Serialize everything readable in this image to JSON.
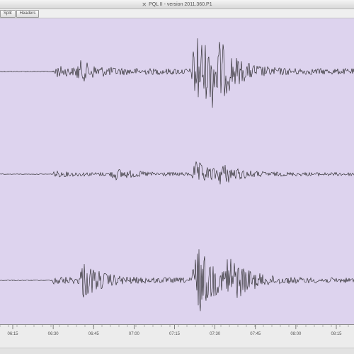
{
  "window": {
    "title": "PQL II - version 2011.360.P1",
    "title_icon": "x-window-icon"
  },
  "toolbar": {
    "buttons": [
      "Split",
      "Headers"
    ]
  },
  "plot": {
    "background": "#ddd3ee",
    "trace_color": "#1a1a1a",
    "traces": [
      {
        "id": "trace-1",
        "events": [
          {
            "t": 0.15,
            "amp": 0.08
          },
          {
            "t": 0.22,
            "amp": 0.18
          },
          {
            "t": 0.55,
            "amp": 0.95
          },
          {
            "t": 0.6,
            "amp": 0.55
          }
        ]
      },
      {
        "id": "trace-2",
        "events": [
          {
            "t": 0.15,
            "amp": 0.06
          },
          {
            "t": 0.32,
            "amp": 0.18
          },
          {
            "t": 0.55,
            "amp": 0.45
          },
          {
            "t": 0.62,
            "amp": 0.3
          }
        ]
      },
      {
        "id": "trace-3",
        "events": [
          {
            "t": 0.15,
            "amp": 0.06
          },
          {
            "t": 0.23,
            "amp": 0.45
          },
          {
            "t": 0.55,
            "amp": 0.95
          },
          {
            "t": 0.64,
            "amp": 0.55
          }
        ]
      }
    ],
    "onset": 0.15
  },
  "axis": {
    "ticks": [
      "06:15",
      "06:30",
      "06:45",
      "07:00",
      "07:15",
      "07:30",
      "07:45",
      "08:00",
      "08:15"
    ]
  }
}
